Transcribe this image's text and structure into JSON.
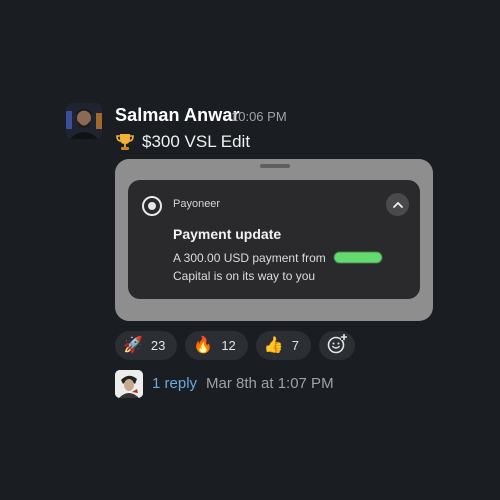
{
  "message": {
    "sender": "Salman Anwar",
    "time": "10:06 PM",
    "text": "$300 VSL Edit",
    "prefix_icon": "trophy-icon"
  },
  "attachment": {
    "app_name": "Payoneer",
    "app_icon": "payoneer-icon",
    "title": "Payment update",
    "body_line1": "A 300.00 USD payment from",
    "body_line2": "Capital is on its way to you",
    "toggle_icon": "chevron-up-icon"
  },
  "reactions": [
    {
      "icon": "rocket-icon",
      "emoji": "🚀",
      "count": "23"
    },
    {
      "icon": "fire-icon",
      "emoji": "🔥",
      "count": "12"
    },
    {
      "icon": "thumbs-up-icon",
      "emoji": "👍",
      "count": "7"
    }
  ],
  "add_reaction_icon": "add-emoji-icon",
  "thread": {
    "reply_label": "1 reply",
    "last_reply": "Mar 8th at 1:07 PM"
  },
  "colors": {
    "background": "#1a1d21",
    "link": "#6aa8e0",
    "attachment_frame": "#8e8e8e",
    "notification_bg": "#2a2a2c"
  }
}
